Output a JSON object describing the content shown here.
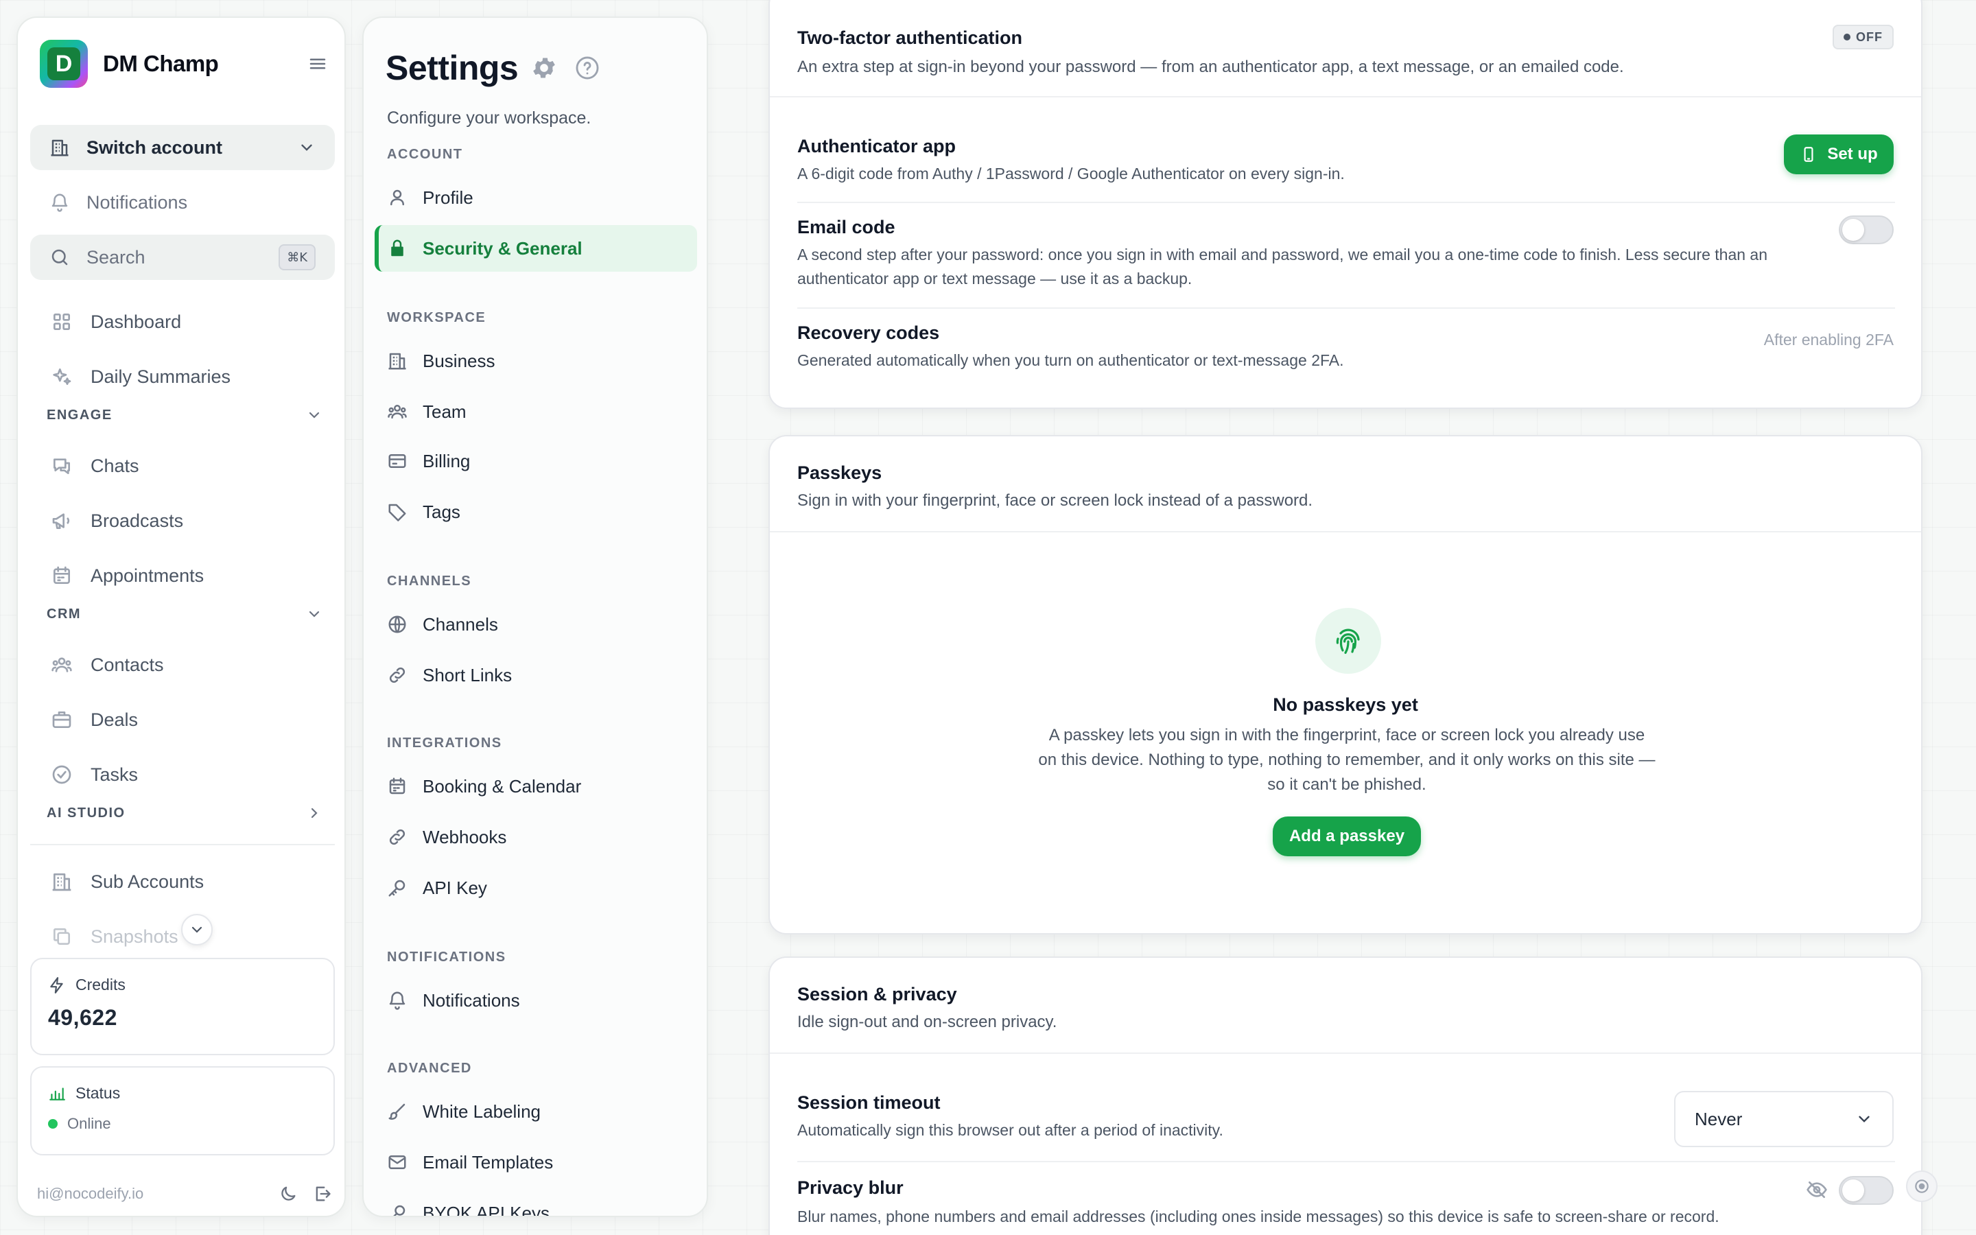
{
  "brand": {
    "name": "DM Champ",
    "logo_letter": "D"
  },
  "sidebar": {
    "switch_account": "Switch account",
    "notifications": "Notifications",
    "search_placeholder": "Search",
    "search_shortcut": "⌘K",
    "items": {
      "dashboard": "Dashboard",
      "daily_summaries": "Daily Summaries",
      "chats": "Chats",
      "broadcasts": "Broadcasts",
      "appointments": "Appointments",
      "contacts": "Contacts",
      "deals": "Deals",
      "tasks": "Tasks",
      "sub_accounts": "Sub Accounts",
      "snapshots": "Snapshots"
    },
    "sections": {
      "engage": "ENGAGE",
      "crm": "CRM",
      "ai_studio": "AI STUDIO"
    },
    "credits": {
      "label": "Credits",
      "value": "49,622"
    },
    "status": {
      "label": "Status",
      "value": "Online",
      "color": "#22c55e"
    },
    "footer_email": "hi@nocodeify.io"
  },
  "settings": {
    "title": "Settings",
    "subtitle": "Configure your workspace.",
    "sections": {
      "account": "ACCOUNT",
      "workspace": "WORKSPACE",
      "channels": "CHANNELS",
      "integrations": "INTEGRATIONS",
      "notifications": "NOTIFICATIONS",
      "advanced": "ADVANCED"
    },
    "items": {
      "profile": "Profile",
      "security": "Security & General",
      "business": "Business",
      "team": "Team",
      "billing": "Billing",
      "tags": "Tags",
      "channels": "Channels",
      "short_links": "Short Links",
      "booking": "Booking & Calendar",
      "webhooks": "Webhooks",
      "api_key": "API Key",
      "notifications": "Notifications",
      "white_labeling": "White Labeling",
      "email_templates": "Email Templates",
      "byok": "BYOK API Keys"
    },
    "active_item": "Security & General"
  },
  "two_factor": {
    "title": "Two-factor authentication",
    "description": "An extra step at sign-in beyond your password — from an authenticator app, a text message, or an emailed code.",
    "badge": "OFF",
    "authenticator": {
      "title": "Authenticator app",
      "description": "A 6-digit code from Authy / 1Password / Google Authenticator on every sign-in.",
      "button": "Set up"
    },
    "email_code": {
      "title": "Email code",
      "description": "A second step after your password: once you sign in with email and password, we email you a one-time code to finish. Less secure than an authenticator app or text message — use it as a backup.",
      "enabled": false
    },
    "recovery": {
      "title": "Recovery codes",
      "description": "Generated automatically when you turn on authenticator or text-message 2FA.",
      "note": "After enabling 2FA"
    }
  },
  "passkeys": {
    "title": "Passkeys",
    "description": "Sign in with your fingerprint, face or screen lock instead of a password.",
    "empty_title": "No passkeys yet",
    "empty_description": "A passkey lets you sign in with the fingerprint, face or screen lock you already use on this device. Nothing to type, nothing to remember, and it only works on this site — so it can't be phished.",
    "button": "Add a passkey"
  },
  "session": {
    "title": "Session & privacy",
    "description": "Idle sign-out and on-screen privacy.",
    "timeout": {
      "title": "Session timeout",
      "description": "Automatically sign this browser out after a period of inactivity.",
      "value": "Never"
    },
    "privacy_blur": {
      "title": "Privacy blur",
      "description": "Blur names, phone numbers and email addresses (including ones inside messages) so this device is safe to screen-share or record.",
      "enabled": false
    }
  },
  "colors": {
    "accent": "#16a34a",
    "accent_light": "#e6f6ec"
  }
}
